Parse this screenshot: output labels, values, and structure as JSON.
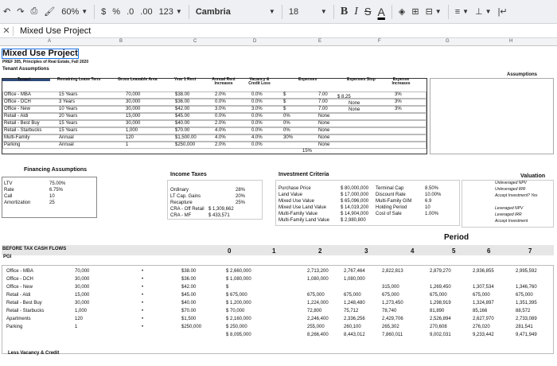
{
  "toolbar": {
    "zoom": "60%",
    "currency": "$",
    "percent": "%",
    "dec_less": ".0",
    "dec_more": ".00",
    "format_more": "123",
    "font": "Cambria",
    "size": "18",
    "bold": "B",
    "italic": "I",
    "strike": "S",
    "text_color": "A"
  },
  "file": {
    "name": "Mixed Use Project"
  },
  "columns": [
    "A",
    "B",
    "C",
    "D",
    "E",
    "F",
    "G",
    "H"
  ],
  "header": {
    "title": "Mixed Use Project",
    "subtitle": "PREF 305, Principles of Real Estate, Fall 2020",
    "tenant_assumptions": "Tenant Assumptions",
    "assumptions": "Assumptions"
  },
  "tenant_table": {
    "headers": [
      "Tenant",
      "Remaining Lease Term",
      "Gross Leasable Area",
      "Year 1 Rent",
      "Annual Rent Increases",
      "Vacancy & Credit Loss",
      "Expenses",
      "Expenses Stop",
      "Expense Increases"
    ],
    "rows": [
      [
        "Office - MBA",
        "15 Years",
        "70,000",
        "$38.00",
        "2.0%",
        "0.0%",
        "$",
        "7.00",
        "3%"
      ],
      [
        "Office - DCH",
        "3 Years",
        "30,000",
        "$36.00",
        "0.0%",
        "0.0%",
        "$",
        "7.00",
        "3%"
      ],
      [
        "Office - New",
        "10 Years",
        "30,000",
        "$42.00",
        "3.0%",
        "3.0%",
        "$",
        "7.00",
        "3%"
      ],
      [
        "Retail - Aldi",
        "20 Years",
        "15,000",
        "$45.00",
        "0.0%",
        "0.0%",
        "0%",
        "None",
        ""
      ],
      [
        "Retail - Best Buy",
        "15 Years",
        "30,000",
        "$40.00",
        "2.0%",
        "0.0%",
        "0%",
        "None",
        ""
      ],
      [
        "Retail - Starbucks",
        "15 Years",
        "1,000",
        "$70.00",
        "4.0%",
        "0.0%",
        "0%",
        "None",
        ""
      ],
      [
        "Multi-Family",
        "Annual",
        "120",
        "$1,500.00",
        "4.0%",
        "4.0%",
        "30%",
        "None",
        ""
      ],
      [
        "Parking",
        "Annual",
        "1",
        "$250,000",
        "2.0%",
        "0.0%",
        "",
        "None",
        ""
      ]
    ],
    "stop_values": [
      "$     8.25",
      "None",
      "None"
    ],
    "total_pct": "15%"
  },
  "financing": {
    "title": "Financing Assumptions",
    "rows": [
      {
        "label": "LTV",
        "value": "75.00%"
      },
      {
        "label": "Rate",
        "value": "6.75%"
      },
      {
        "label": "Call",
        "value": "10"
      },
      {
        "label": "Amortization",
        "value": "25"
      }
    ]
  },
  "income_taxes": {
    "title": "Income Taxes",
    "rows": [
      {
        "label": "Ordinary",
        "value": "28%"
      },
      {
        "label": "LT Cap. Gains",
        "value": "20%"
      },
      {
        "label": "Recapture",
        "value": "25%"
      },
      {
        "label": "CRA - Off Retail",
        "value": "$   1,309,662"
      },
      {
        "label": "CRA - MF",
        "value": "$      433,571"
      }
    ]
  },
  "investment": {
    "title": "Investment Criteria",
    "left": [
      {
        "label": "Purchase Price",
        "value": "$  80,000,000"
      },
      {
        "label": "Land Value",
        "value": "$  17,000,000"
      },
      {
        "label": "Mixed Use Value",
        "value": "$  65,096,000"
      },
      {
        "label": "Mixed Use Land Value",
        "value": "$  14,019,200"
      },
      {
        "label": "Multi-Family Value",
        "value": "$  14,904,000"
      },
      {
        "label": "Multi-Family Land Value",
        "value": "$    2,980,800"
      }
    ],
    "right": [
      {
        "label": "Terminal Cap",
        "value": "8.50%"
      },
      {
        "label": "Discount Rate",
        "value": "10.00%"
      },
      {
        "label": "Multi-Family GIM",
        "value": "6.9"
      },
      {
        "label": "Holding Period",
        "value": "10"
      },
      {
        "label": "Cost of Sale",
        "value": "1.00%"
      }
    ]
  },
  "valuation": {
    "title": "Valuation",
    "rows": [
      "Unleveraged NPV",
      "Unleveraged IRR",
      "Accept Investment? Yes",
      "",
      "Leveraged NPV",
      "Leveraged IRR",
      "Accept Investment"
    ]
  },
  "period": {
    "label": "Period",
    "numbers": [
      "0",
      "1",
      "2",
      "3",
      "4",
      "5",
      "6",
      "7"
    ]
  },
  "btcf": {
    "title": "BEFORE TAX CASH FLOWS",
    "pgi": "PGI",
    "tenants": [
      "Office - MBA",
      "Office - DCH",
      "Office - New",
      "Retail - Aldi",
      "Retail - Best Buy",
      "Retail - Starbucks",
      "Apartments",
      "Parking"
    ],
    "gla": [
      "70,000",
      "30,000",
      "30,000",
      "15,000",
      "30,000",
      "1,000",
      "120",
      "1"
    ],
    "rent": [
      "$38.00",
      "$36.00",
      "$42.00",
      "$45.00",
      "$40.00",
      "$70.00",
      "$1,500",
      "$250,000"
    ],
    "p1": [
      "$  2,660,000",
      "$  1,080,000",
      "$",
      "$     675,000",
      "$  1,200,000",
      "$        70,000",
      "$  2,160,000",
      "$     250,000"
    ],
    "p1_total": "$  8,095,000",
    "p2": [
      "2,713,200",
      "1,080,000",
      "",
      "675,000",
      "1,224,000",
      "72,800",
      "2,246,400",
      "255,000"
    ],
    "p2_total": "8,266,400",
    "p3": [
      "2,767,464",
      "1,080,000",
      "",
      "675,000",
      "1,248,480",
      "75,712",
      "2,336,256",
      "260,100"
    ],
    "p3_total": "8,443,012",
    "p4": [
      "2,822,813",
      "",
      "315,000",
      "675,000",
      "1,273,450",
      "78,740",
      "2,429,706",
      "265,302"
    ],
    "p4_total": "7,860,011",
    "p5": [
      "2,879,270",
      "",
      "1,269,450",
      "675,000",
      "1,298,919",
      "81,890",
      "2,526,894",
      "270,608"
    ],
    "p5_total": "9,002,031",
    "p6": [
      "2,936,855",
      "",
      "1,307,534",
      "675,000",
      "1,324,897",
      "85,166",
      "2,627,970",
      "276,020"
    ],
    "p6_total": "9,233,442",
    "p7": [
      "2,995,592",
      "",
      "1,346,760",
      "675,000",
      "1,351,395",
      "88,572",
      "2,733,089",
      "281,541"
    ],
    "p7_total": "9,471,949",
    "less_vacancy": "Less Vacancy & Credit"
  }
}
